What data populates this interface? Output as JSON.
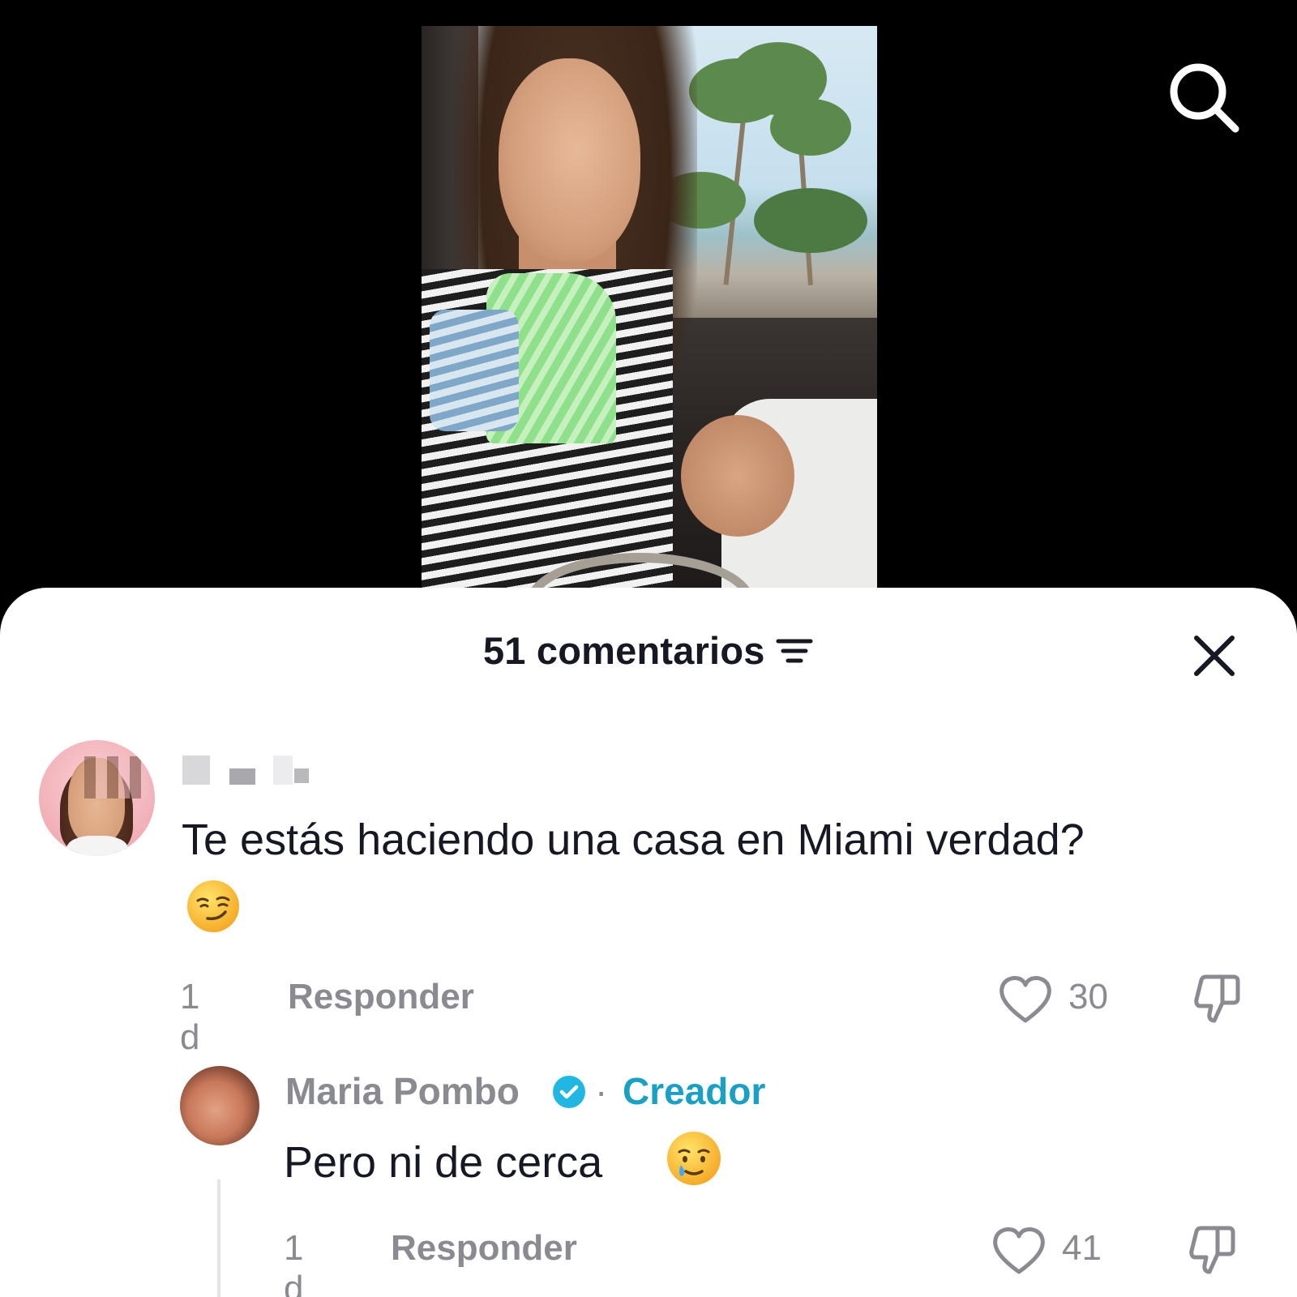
{
  "video": {
    "search_icon": "search-icon"
  },
  "sheet": {
    "title": "51 comentarios",
    "sort_icon": "sort-lines-icon",
    "close_icon": "close-icon"
  },
  "comments": [
    {
      "username": "",
      "text": "Te estás haciendo una casa en Miami verdad?",
      "emoji": "😏",
      "time": "1 d",
      "reply_label": "Responder",
      "likes": "30"
    },
    {
      "username": "Maria Pombo",
      "verified": true,
      "separator": "·",
      "role": "Creador",
      "text": "Pero ni de cerca",
      "emoji": "🥲",
      "time": "1 d",
      "reply_label": "Responder",
      "likes": "41"
    }
  ],
  "colors": {
    "background": "#000000",
    "sheet": "#ffffff",
    "text_primary": "#161823",
    "text_secondary": "#8a8b91",
    "creator_accent": "#1aa0c4",
    "verified_badge": "#20b8e3"
  }
}
